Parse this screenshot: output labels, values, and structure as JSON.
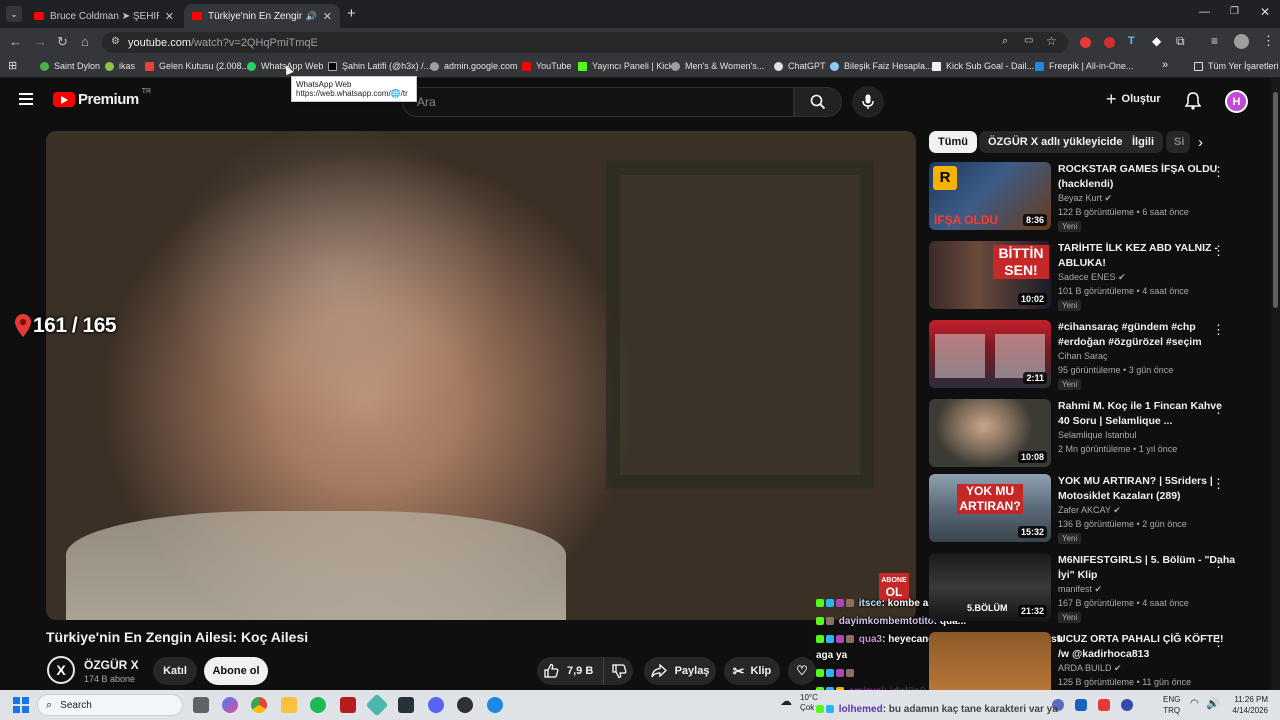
{
  "browser": {
    "tabs": [
      {
        "title": "Bruce Coldman ➤ ŞEHİRDE AS...",
        "active": false
      },
      {
        "title": "Türkiye'nin En Zengin Ailesi",
        "active": true
      }
    ],
    "url_host": "youtube.com",
    "url_path": "/watch?v=2QHqPmiTmqE",
    "bookmarks": [
      "Saint Dylon",
      "ikas",
      "Gelen Kutusu (2.008...",
      "WhatsApp Web",
      "Şahin Latifi (@h3x) /...",
      "admin.google.com",
      "YouTube",
      "Yayıncı Paneli | Kick",
      "Men's & Women's...",
      "ChatGPT",
      "Bileşik Faiz Hesapla...",
      "Kick Sub Goal - Dail...",
      "Freepik | All-in-One..."
    ],
    "all_bookmarks_label": "Tüm Yer İşaretleri",
    "tooltip": {
      "title": "WhatsApp Web",
      "url": "https://web.whatsapp.com/🌐/tr"
    }
  },
  "youtube": {
    "logo_text": "Premium",
    "logo_region": "TR",
    "search_placeholder": "Ara",
    "create_label": "Oluştur",
    "avatar_letter": "H"
  },
  "video": {
    "overlay_counter": "161 / 165",
    "title": "Türkiye'nin En Zengin Ailesi: Koç Ailesi",
    "channel_name": "ÖZGÜR X",
    "channel_initial": "X",
    "subscribers": "174 B abone",
    "join_label": "Katıl",
    "subscribe_label": "Abone ol",
    "likes": "7,9 B",
    "share_label": "Paylaş",
    "clip_label": "Klip",
    "abone_badge_line1": "ABONE",
    "abone_badge_line2": "OL"
  },
  "chips": [
    "Tümü",
    "ÖZGÜR X adlı yükleyiciden",
    "İlgili",
    "Si"
  ],
  "recommendations": [
    {
      "title": "ROCKSTAR GAMES İFŞA OLDU (hacklendi)",
      "channel": "Beyaz Kurt",
      "meta": "122 B görüntüleme • 6 saat önce",
      "badge": "Yeni",
      "duration": "8:36",
      "thumb_text": "İFŞA OLDU",
      "thumb_color": "#1c3a5e"
    },
    {
      "title": "TARİHTE İLK KEZ ABD YALNIZ - ABLUKA!",
      "channel": "Sadece ENES",
      "meta": "101 B görüntüleme • 4 saat önce",
      "badge": "Yeni",
      "duration": "10:02",
      "thumb_text": "BİTTİN SEN!",
      "thumb_color": "#2a1818"
    },
    {
      "title": "#cihansaraç #gündem #chp #erdoğan #özgürözel #seçim",
      "channel": "Cihan Saraç",
      "meta": "95 görüntüleme • 3 gün önce",
      "badge": "Yeni",
      "duration": "2:11",
      "thumb_text": "",
      "thumb_color": "#c3202c"
    },
    {
      "title": "Rahmi M. Koç ile 1 Fincan Kahve 40 Soru | Selamlique ...",
      "channel": "Selamlique Istanbul",
      "meta": "2 Mn görüntüleme • 1 yıl önce",
      "badge": "",
      "duration": "10:08",
      "thumb_text": "",
      "thumb_color": "#7a6a58"
    },
    {
      "title": "YOK MU ARTIRAN? | 5Sriders | Motosiklet Kazaları (289)",
      "channel": "Zafer AKCAY",
      "meta": "136 B görüntüleme • 2 gün önce",
      "badge": "Yeni",
      "duration": "15:32",
      "thumb_text": "YOK MU ARTIRAN?",
      "thumb_color": "#5b6a78"
    },
    {
      "title": "M6NIFESTGIRLS | 5. Bölüm - \"Daha İyi\" Klip",
      "channel": "manifest",
      "meta": "167 B görüntüleme • 4 saat önce",
      "badge": "Yeni",
      "duration": "21:32",
      "thumb_text": "5.BÖLÜM",
      "thumb_color": "#2c2c2c"
    },
    {
      "title": "UCUZ ORTA PAHALI ÇİĞ KÖFTE!",
      "channel": "ARDA BUILD",
      "meta": "125 B görüntüleme • 11 gün önce",
      "badge": "",
      "duration": "",
      "thumb_text": "",
      "thumb_color": "#8a5a2a"
    }
  ],
  "chat": [
    {
      "user": "itsce",
      "msg": ": kombe astın mı kendini."
    },
    {
      "user": "dayimkombemtotito",
      "msg": ": qua..."
    },
    {
      "user": "qua3",
      "msg": ": heyecandan yanlışlıkla sende e bastı"
    },
    {
      "user": "",
      "msg": "aga ya"
    },
    {
      "user": "",
      "msg": ""
    },
    {
      "user": "emiryei",
      "msg": ": idolünü izliyor yine"
    },
    {
      "user": "lolhemed",
      "msg": ": bu adamın kaç tane karakteri var ya"
    }
  ],
  "chat_tail": "/w @kadirhoca813",
  "taskbar": {
    "search_placeholder": "Search",
    "weather": "10°C",
    "weather_sub": "Çok",
    "lang": "ENG",
    "lang_sub": "TRQ",
    "time": "11:26 PM",
    "date": "4/14/2026"
  },
  "colors": {
    "yt_red": "#ff0000",
    "bg": "#0f0f0f",
    "chip": "#272727",
    "accent_purple": "#c04bd8",
    "kick_green": "#53fc18"
  }
}
